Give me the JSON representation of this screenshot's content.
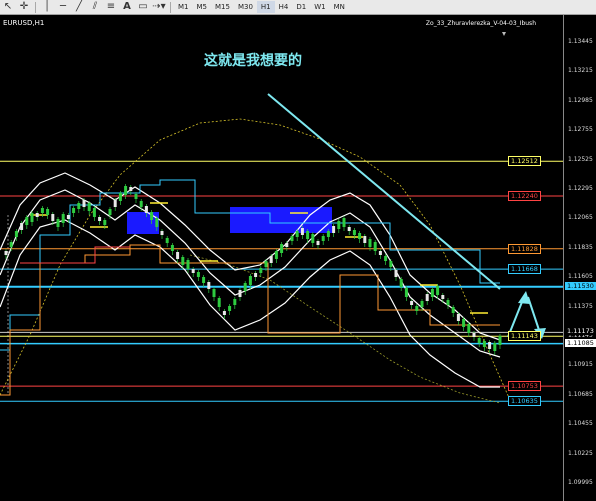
{
  "toolbar": {
    "timeframes": [
      "M1",
      "M5",
      "M15",
      "M30",
      "H1",
      "H4",
      "D1",
      "W1",
      "MN"
    ],
    "active_timeframe": "H1"
  },
  "chart": {
    "symbol": "EURUSD,H1",
    "indicator": "Zo_33_Zhuravlerezka_V-04-03_Ibush",
    "annotation": "这就是我想要的",
    "price_axis": [
      "1.13445",
      "1.13215",
      "1.12985",
      "1.12755",
      "1.12525",
      "1.12295",
      "1.12065",
      "1.11835",
      "1.11605",
      "1.11375",
      "1.11145",
      "1.10915",
      "1.10685",
      "1.10455",
      "1.10225",
      "1.09995"
    ],
    "axis_values": [
      1.13445,
      1.13215,
      1.12985,
      1.12755,
      1.12525,
      1.12295,
      1.12065,
      1.11835,
      1.11605,
      1.11375,
      1.11145,
      1.10915,
      1.10685,
      1.10455,
      1.10225,
      1.09995
    ],
    "levels": [
      {
        "label": "1.12512",
        "value": 1.12512,
        "color": "#ffff66"
      },
      {
        "label": "1.12240",
        "value": 1.1224,
        "color": "#ff4444"
      },
      {
        "label": "1.11828",
        "value": 1.11828,
        "color": "#ff9933"
      },
      {
        "label": "1.11668",
        "value": 1.11668,
        "color": "#33ccff"
      },
      {
        "label": "1.11143",
        "value": 1.11143,
        "color": "#ffff66"
      },
      {
        "label": "1.10753",
        "value": 1.10753,
        "color": "#ff4444"
      },
      {
        "label": "1.10635",
        "value": 1.10635,
        "color": "#33ccff"
      }
    ],
    "bid_line": {
      "label": "1.11530",
      "value": 1.1153,
      "color": "#33ccff"
    },
    "ask_boxes": [
      {
        "label": "1.11173",
        "value": 1.11173,
        "bg": "#000000",
        "fg": "#ffffff"
      },
      {
        "label": "1.11085",
        "value": 1.11085,
        "bg": "#ffffff",
        "fg": "#000000"
      }
    ]
  }
}
